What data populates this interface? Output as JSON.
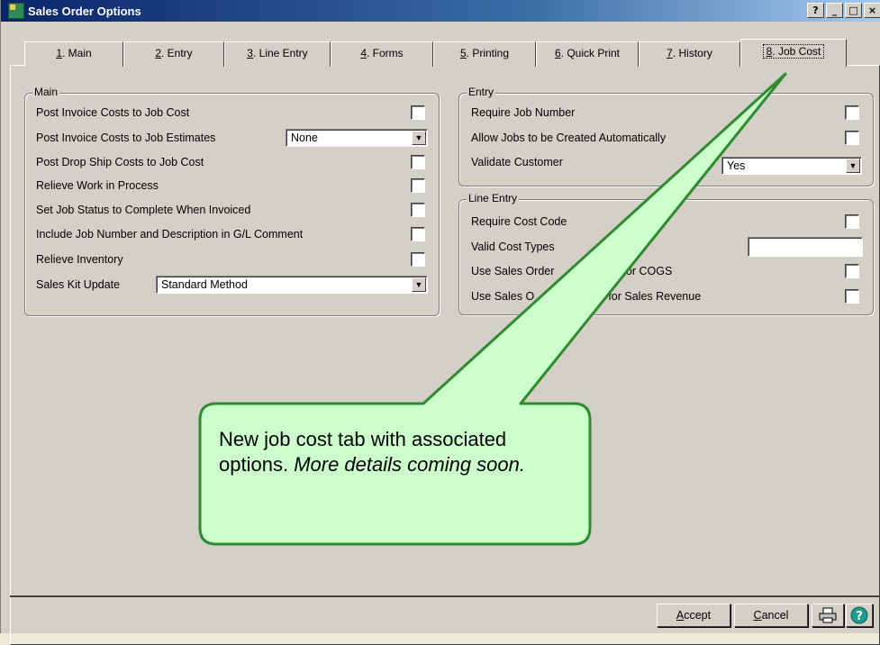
{
  "window": {
    "title": "Sales Order Options",
    "buttons": [
      "?",
      "_",
      "□",
      "×"
    ]
  },
  "tabs": [
    {
      "hotkey": "1",
      "label": ". Main",
      "active": false
    },
    {
      "hotkey": "2",
      "label": ". Entry",
      "active": false
    },
    {
      "hotkey": "3",
      "label": ". Line Entry",
      "active": false
    },
    {
      "hotkey": "4",
      "label": ". Forms",
      "active": false
    },
    {
      "hotkey": "5",
      "label": ". Printing",
      "active": false
    },
    {
      "hotkey": "6",
      "label": ". Quick Print",
      "active": false
    },
    {
      "hotkey": "7",
      "label": ". History",
      "active": false
    },
    {
      "hotkey": "8",
      "label": ". Job Cost",
      "active": true
    }
  ],
  "main": {
    "title": "Main",
    "options": [
      {
        "label": "Post Invoice Costs to Job Cost",
        "checked": false
      },
      {
        "label": "Post Invoice Costs to Job Estimates",
        "value": "None"
      },
      {
        "label": "Post Drop Ship Costs to Job Cost",
        "checked": false
      },
      {
        "label": "Relieve Work in Process",
        "checked": false
      },
      {
        "label": "Set Job Status to Complete When Invoiced",
        "checked": false
      },
      {
        "label": "Include Job Number and Description in G/L Comment",
        "checked": false
      },
      {
        "label": "Relieve Inventory",
        "checked": false
      },
      {
        "label": "Sales Kit Update",
        "value": "Standard Method"
      }
    ]
  },
  "entry": {
    "title": "Entry",
    "options": [
      {
        "label": "Require Job Number",
        "checked": false
      },
      {
        "label": "Allow Jobs to be Created Automatically",
        "checked": false
      },
      {
        "label": "Validate Customer",
        "value": "Yes"
      }
    ]
  },
  "line_entry": {
    "title": "Line Entry",
    "options": [
      {
        "label": "Require Cost Code",
        "checked": false
      },
      {
        "label": "Valid Cost Types",
        "value": ""
      },
      {
        "label": "Use Sales Order",
        "label_tail": "for COGS",
        "checked": false
      },
      {
        "label": "Use Sales O",
        "label_tail": "nts for Sales Revenue",
        "checked": false
      }
    ]
  },
  "callout": {
    "text": "New job cost tab with associated options.",
    "text_italic": "More details coming soon.",
    "fill": "#ccffcc",
    "stroke": "#2e8b2e"
  },
  "buttons": {
    "accept_hotkey": "A",
    "accept_rest": "ccept",
    "cancel_hotkey": "C",
    "cancel_rest": "ancel"
  }
}
